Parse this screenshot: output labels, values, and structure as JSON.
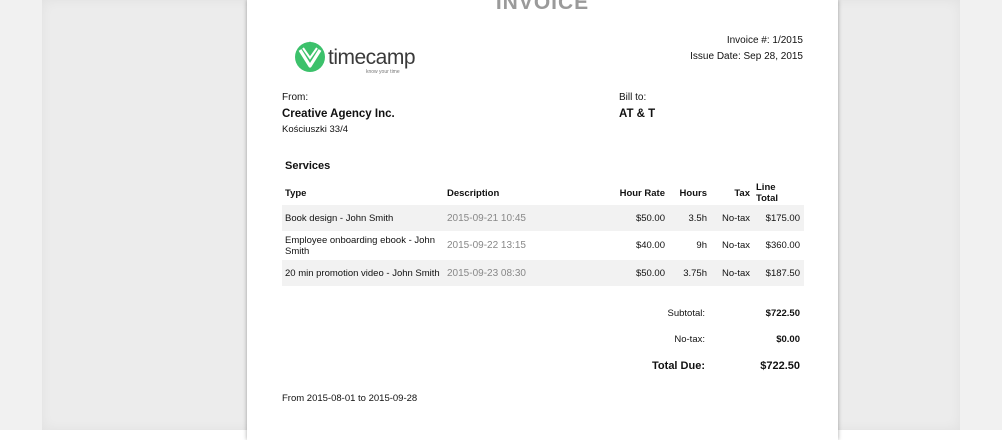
{
  "document": {
    "title": "INVOICE",
    "logo": {
      "brand": "timecamp",
      "tagline": "know your time"
    },
    "invoice_number": "Invoice #: 1/2015",
    "issue_date": "Issue Date: Sep 28, 2015",
    "from": {
      "label": "From:",
      "name": "Creative Agency Inc.",
      "address": "Kościuszki 33/4"
    },
    "bill_to": {
      "label": "Bill to:",
      "name": "AT & T"
    },
    "services_title": "Services",
    "columns": [
      "Type",
      "Description",
      "Hour Rate",
      "Hours",
      "Tax",
      "Line Total"
    ],
    "rows": [
      {
        "type": "Book design - John Smith",
        "description": "2015-09-21 10:45",
        "rate": "$50.00",
        "hours": "3.5h",
        "tax": "No-tax",
        "total": "$175.00"
      },
      {
        "type": "Employee onboarding ebook - John Smith",
        "description": "2015-09-22 13:15",
        "rate": "$40.00",
        "hours": "9h",
        "tax": "No-tax",
        "total": "$360.00"
      },
      {
        "type": "20 min promotion video - John Smith",
        "description": "2015-09-23 08:30",
        "rate": "$50.00",
        "hours": "3.75h",
        "tax": "No-tax",
        "total": "$187.50"
      }
    ],
    "summary": {
      "subtotal_label": "Subtotal:",
      "subtotal": "$722.50",
      "tax_label": "No-tax:",
      "tax": "$0.00",
      "total_label": "Total Due:",
      "total": "$722.50"
    },
    "period": "From 2015-08-01 to 2015-09-28"
  },
  "colors": {
    "brand_green": "#3cc16b",
    "title_gray": "#9a9a9a",
    "row_shade": "#f2f2f2"
  }
}
